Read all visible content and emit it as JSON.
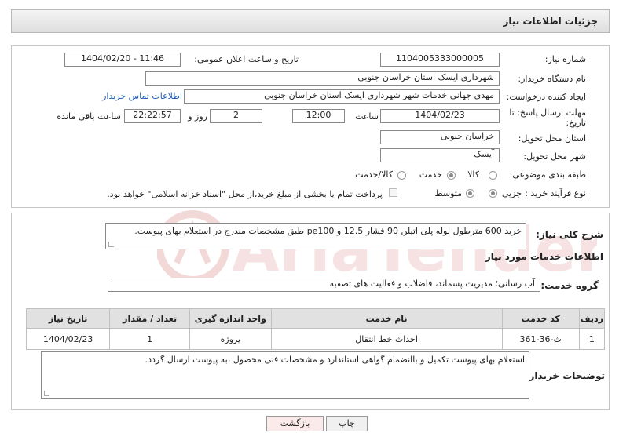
{
  "header": {
    "title": "جزئیات اطلاعات نیاز"
  },
  "need": {
    "number_label": "شماره نیاز:",
    "number_value": "1104005333000005",
    "announce_label": "تاریخ و ساعت اعلان عمومی:",
    "announce_value": "1404/02/20 - 11:46",
    "buyer_org_label": "نام دستگاه خریدار:",
    "buyer_org_value": "شهرداری ایسک استان خراسان جنوبی",
    "creator_label": "ایجاد کننده درخواست:",
    "creator_value": "مهدی جهانی خدمات شهر شهرداری ایسک استان خراسان جنوبی",
    "contact_link": "اطلاعات تماس خریدار",
    "deadline_label": "مهلت ارسال پاسخ: تا تاریخ:",
    "deadline_date": "1404/02/23",
    "time_label": "ساعت",
    "deadline_time": "12:00",
    "days_value": "2",
    "days_label": "روز و",
    "remaining_value": "22:22:57",
    "remaining_label": "ساعت باقی مانده",
    "province_label": "استان محل تحویل:",
    "province_value": "خراسان جنوبی",
    "city_label": "شهر محل تحویل:",
    "city_value": "آیسک",
    "category_label": "طبقه بندی موضوعی:",
    "category_options": [
      "کالا",
      "خدمت",
      "کالا/خدمت"
    ],
    "category_selected": "خدمت",
    "process_label": "نوع فرآیند خرید :",
    "process_options": [
      "جزیی",
      "متوسط"
    ],
    "process_selected": "جزیی",
    "payment_note": "پرداخت تمام یا بخشی از مبلغ خرید،از محل \"اسناد خزانه اسلامی\" خواهد بود."
  },
  "description": {
    "label": "شرح کلی نیاز:",
    "value": "خرید 600 مترطول لوله پلی اتیلن 90 فشار 12.5 و pe100  طبق مشخصات مندرج در استعلام بهای پیوست."
  },
  "services": {
    "section_title": "اطلاعات خدمات مورد نیاز",
    "group_label": "گروه خدمت:",
    "group_value": "آب رسانی؛ مدیریت پسماند، فاضلاب و فعالیت های تصفیه",
    "columns": [
      "ردیف",
      "کد خدمت",
      "نام خدمت",
      "واحد اندازه گیری",
      "تعداد / مقدار",
      "تاریخ نیاز"
    ],
    "rows": [
      {
        "index": "1",
        "code": "ث-36-361",
        "name": "احداث خط انتقال",
        "unit": "پروژه",
        "qty": "1",
        "date": "1404/02/23"
      }
    ]
  },
  "buyer_notes": {
    "label": "توضیحات خریدار:",
    "value": "استعلام بهای پیوست تکمیل و باانضمام گواهی استاندارد و مشخصات فنی  محصول ،به پیوست ارسال گردد."
  },
  "buttons": {
    "print": "چاپ",
    "back": "بازگشت"
  },
  "watermark": {
    "text": "AriaTender.net"
  }
}
